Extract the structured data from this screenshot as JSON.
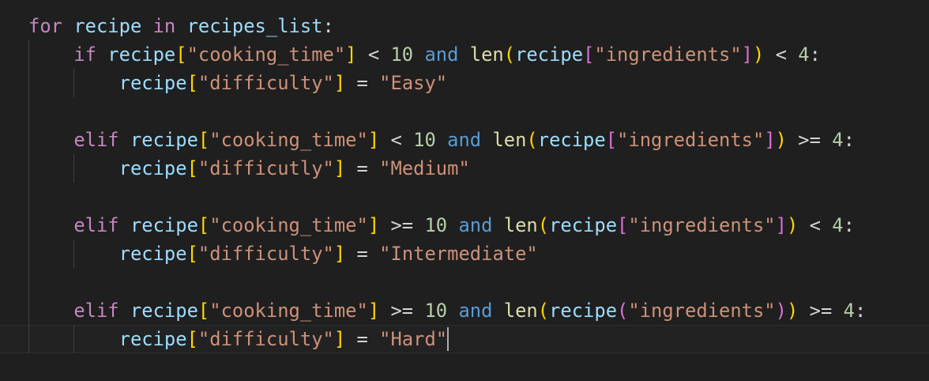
{
  "editor": {
    "colors": {
      "background": "#1f1f1f",
      "keyword": "#C586C0",
      "variable": "#9CDCFE",
      "string": "#CE9178",
      "number": "#B5CEA8",
      "logical": "#569CD6",
      "function": "#DCDCAA",
      "bracket1": "#FFD700",
      "bracket2": "#DA70D6"
    },
    "current_line": 12,
    "lines": [
      {
        "indent": 0,
        "tokens": [
          [
            "kw",
            "for"
          ],
          [
            "op",
            " "
          ],
          [
            "var",
            "recipe"
          ],
          [
            "op",
            " "
          ],
          [
            "kw",
            "in"
          ],
          [
            "op",
            " "
          ],
          [
            "var",
            "recipes_list"
          ],
          [
            "op",
            ":"
          ]
        ]
      },
      {
        "indent": 1,
        "tokens": [
          [
            "kw",
            "if"
          ],
          [
            "op",
            " "
          ],
          [
            "var",
            "recipe"
          ],
          [
            "b1",
            "["
          ],
          [
            "str",
            "\"cooking_time\""
          ],
          [
            "b1",
            "]"
          ],
          [
            "op",
            " < "
          ],
          [
            "num",
            "10"
          ],
          [
            "op",
            " "
          ],
          [
            "and",
            "and"
          ],
          [
            "op",
            " "
          ],
          [
            "fn",
            "len"
          ],
          [
            "b1",
            "("
          ],
          [
            "var",
            "recipe"
          ],
          [
            "b2",
            "["
          ],
          [
            "str",
            "\"ingredients\""
          ],
          [
            "b2",
            "]"
          ],
          [
            "b1",
            ")"
          ],
          [
            "op",
            " < "
          ],
          [
            "num",
            "4"
          ],
          [
            "op",
            ":"
          ]
        ]
      },
      {
        "indent": 2,
        "tokens": [
          [
            "var",
            "recipe"
          ],
          [
            "b1",
            "["
          ],
          [
            "str",
            "\"difficulty\""
          ],
          [
            "b1",
            "]"
          ],
          [
            "op",
            " = "
          ],
          [
            "str",
            "\"Easy\""
          ]
        ]
      },
      {
        "indent": 1,
        "tokens": []
      },
      {
        "indent": 1,
        "tokens": [
          [
            "kw",
            "elif"
          ],
          [
            "op",
            " "
          ],
          [
            "var",
            "recipe"
          ],
          [
            "b1",
            "["
          ],
          [
            "str",
            "\"cooking_time\""
          ],
          [
            "b1",
            "]"
          ],
          [
            "op",
            " < "
          ],
          [
            "num",
            "10"
          ],
          [
            "op",
            " "
          ],
          [
            "and",
            "and"
          ],
          [
            "op",
            " "
          ],
          [
            "fn",
            "len"
          ],
          [
            "b1",
            "("
          ],
          [
            "var",
            "recipe"
          ],
          [
            "b2",
            "["
          ],
          [
            "str",
            "\"ingredients\""
          ],
          [
            "b2",
            "]"
          ],
          [
            "b1",
            ")"
          ],
          [
            "op",
            " >= "
          ],
          [
            "num",
            "4"
          ],
          [
            "op",
            ":"
          ]
        ]
      },
      {
        "indent": 2,
        "tokens": [
          [
            "var",
            "recipe"
          ],
          [
            "b1",
            "["
          ],
          [
            "str",
            "\"difficutly\""
          ],
          [
            "b1",
            "]"
          ],
          [
            "op",
            " = "
          ],
          [
            "str",
            "\"Medium\""
          ]
        ]
      },
      {
        "indent": 1,
        "tokens": []
      },
      {
        "indent": 1,
        "tokens": [
          [
            "kw",
            "elif"
          ],
          [
            "op",
            " "
          ],
          [
            "var",
            "recipe"
          ],
          [
            "b1",
            "["
          ],
          [
            "str",
            "\"cooking_time\""
          ],
          [
            "b1",
            "]"
          ],
          [
            "op",
            " >= "
          ],
          [
            "num",
            "10"
          ],
          [
            "op",
            " "
          ],
          [
            "and",
            "and"
          ],
          [
            "op",
            " "
          ],
          [
            "fn",
            "len"
          ],
          [
            "b1",
            "("
          ],
          [
            "var",
            "recipe"
          ],
          [
            "b2",
            "["
          ],
          [
            "str",
            "\"ingredients\""
          ],
          [
            "b2",
            "]"
          ],
          [
            "b1",
            ")"
          ],
          [
            "op",
            " < "
          ],
          [
            "num",
            "4"
          ],
          [
            "op",
            ":"
          ]
        ]
      },
      {
        "indent": 2,
        "tokens": [
          [
            "var",
            "recipe"
          ],
          [
            "b1",
            "["
          ],
          [
            "str",
            "\"difficulty\""
          ],
          [
            "b1",
            "]"
          ],
          [
            "op",
            " = "
          ],
          [
            "str",
            "\"Intermediate\""
          ]
        ]
      },
      {
        "indent": 1,
        "tokens": []
      },
      {
        "indent": 1,
        "tokens": [
          [
            "kw",
            "elif"
          ],
          [
            "op",
            " "
          ],
          [
            "var",
            "recipe"
          ],
          [
            "b1",
            "["
          ],
          [
            "str",
            "\"cooking_time\""
          ],
          [
            "b1",
            "]"
          ],
          [
            "op",
            " >= "
          ],
          [
            "num",
            "10"
          ],
          [
            "op",
            " "
          ],
          [
            "and",
            "and"
          ],
          [
            "op",
            " "
          ],
          [
            "fn",
            "len"
          ],
          [
            "b1",
            "("
          ],
          [
            "var",
            "recipe"
          ],
          [
            "b2",
            "("
          ],
          [
            "str",
            "\"ingredients\""
          ],
          [
            "b2",
            ")"
          ],
          [
            "b1",
            ")"
          ],
          [
            "op",
            " >= "
          ],
          [
            "num",
            "4"
          ],
          [
            "op",
            ":"
          ]
        ]
      },
      {
        "indent": 2,
        "tokens": [
          [
            "var",
            "recipe"
          ],
          [
            "b1",
            "["
          ],
          [
            "str",
            "\"difficulty\""
          ],
          [
            "b1",
            "]"
          ],
          [
            "op",
            " = "
          ],
          [
            "str",
            "\"Hard\""
          ]
        ]
      }
    ]
  }
}
